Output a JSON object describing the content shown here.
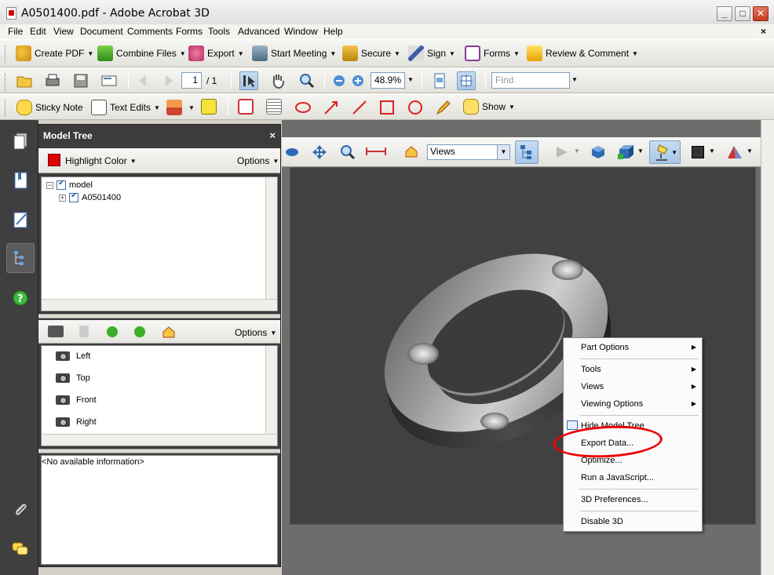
{
  "window": {
    "title": "A0501400.pdf - Adobe Acrobat 3D",
    "min": "_",
    "max": "□",
    "close": "✕"
  },
  "menu": [
    "File",
    "Edit",
    "View",
    "Document",
    "Comments",
    "Forms",
    "Tools",
    "Advanced",
    "Window",
    "Help"
  ],
  "menu_close": "×",
  "toolbar1": [
    "Create PDF",
    "Combine Files",
    "Export",
    "Start Meeting",
    "Secure",
    "Sign",
    "Forms",
    "Review & Comment"
  ],
  "toolbar2": {
    "page": "1",
    "page_total": "/ 1",
    "zoom": "48.9%",
    "find_placeholder": "Find"
  },
  "toolbar3": {
    "sticky_note": "Sticky Note",
    "text_edits": "Text Edits",
    "show": "Show"
  },
  "model_tree": {
    "title": "Model Tree",
    "close": "×",
    "highlight_color": "Highlight Color",
    "highlight_swatch": "#e00000",
    "options": "Options",
    "tree": [
      {
        "label": "model"
      },
      {
        "label": "A0501400"
      }
    ],
    "views_options": "Options",
    "views": [
      "Left",
      "Top",
      "Front",
      "Right"
    ],
    "info": "<No available information>"
  },
  "viewer_toolbar": {
    "views_select": "Views"
  },
  "context_menu": {
    "items": [
      {
        "label": "Part Options",
        "submenu": true
      },
      {
        "label": "Tools",
        "submenu": true
      },
      {
        "label": "Views",
        "submenu": true
      },
      {
        "label": "Viewing Options",
        "submenu": true
      },
      {
        "label": "Hide Model Tree",
        "submenu": false
      },
      {
        "label": "Export Data...",
        "submenu": false
      },
      {
        "label": "Optimize...",
        "submenu": false
      },
      {
        "label": "Run a JavaScript...",
        "submenu": false
      },
      {
        "label": "3D Preferences...",
        "submenu": false
      },
      {
        "label": "Disable 3D",
        "submenu": false
      }
    ]
  },
  "colors": {
    "annotation": "#e00000",
    "viewer_bg": "#414141",
    "panel_bg": "#3c3c3c"
  }
}
